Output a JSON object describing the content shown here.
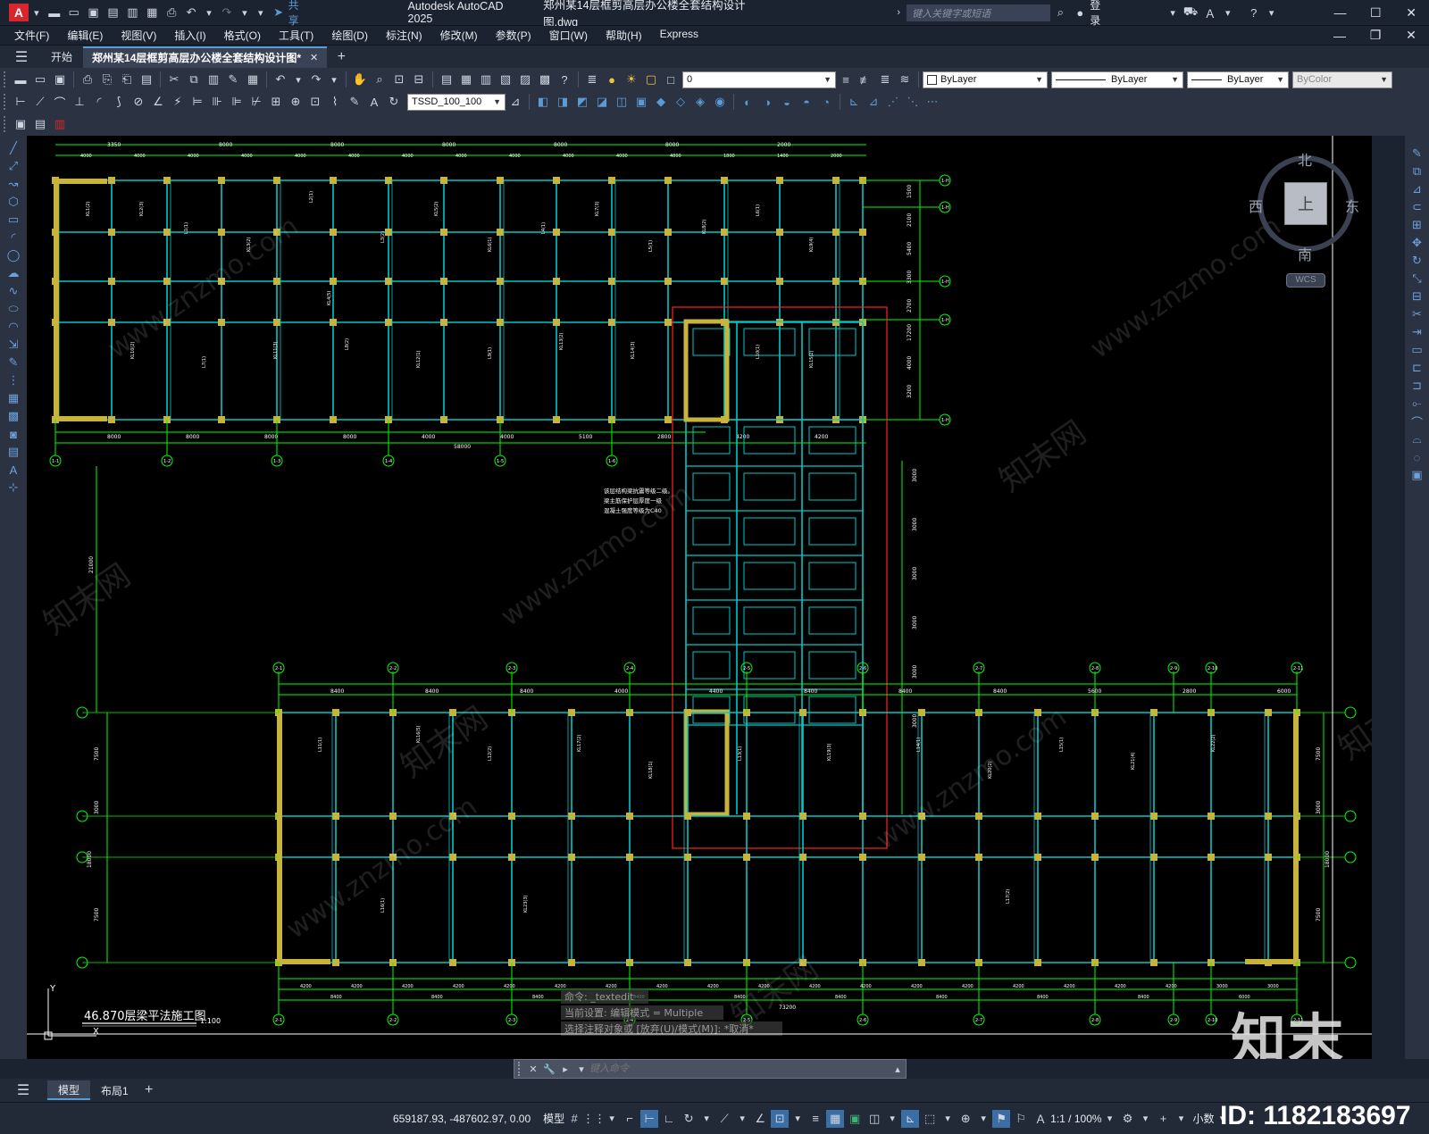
{
  "app": {
    "title": "Autodesk AutoCAD 2025",
    "document": "郑州某14层框剪高层办公楼全套结构设计图.dwg",
    "search_placeholder": "键入关键字或短语",
    "login": "登录",
    "share": "共享"
  },
  "menu": [
    "文件(F)",
    "编辑(E)",
    "视图(V)",
    "插入(I)",
    "格式(O)",
    "工具(T)",
    "绘图(D)",
    "标注(N)",
    "修改(M)",
    "参数(P)",
    "窗口(W)",
    "帮助(H)",
    "Express"
  ],
  "tabs": {
    "start": "开始",
    "doc": "郑州某14层框剪高层办公楼全套结构设计图*"
  },
  "toolbar": {
    "layer_value": "0",
    "color": "ByLayer",
    "linetype": "ByLayer",
    "lineweight": "ByLayer",
    "plotstyle": "ByColor",
    "dimstyle": "TSSD_100_100"
  },
  "viewcube": {
    "north": "北",
    "south": "南",
    "east": "东",
    "west": "西",
    "face": "上",
    "wcs": "WCS"
  },
  "drawing": {
    "title": "46.870层梁平法施工图",
    "scale": "1:100",
    "note_lines": [
      "该层结构梁抗震等级二级。",
      "梁主筋保护层厚度一级",
      "混凝土强度等级为C40"
    ],
    "top_dims_1": [
      "3350",
      "8000",
      "8000",
      "8000",
      "8000",
      "8000",
      "2000"
    ],
    "top_dims_2": [
      "4000",
      "4000",
      "4000",
      "4000",
      "4000",
      "4000",
      "4000",
      "4000",
      "4000",
      "4000",
      "4000",
      "4800",
      "1800",
      "1400",
      "2000"
    ],
    "top_bottom_dims": [
      "8000",
      "8000",
      "8000",
      "8000",
      "4000",
      "4000",
      "5100",
      "2800",
      "4200",
      "4200"
    ],
    "top_total": "58000",
    "top_axes": [
      "1-1",
      "1-2",
      "1-3",
      "1-4",
      "1-5",
      "1-6"
    ],
    "top_right_axes": [
      "1-H",
      "1-H",
      "1-H",
      "1-H",
      "1-H"
    ],
    "right_dims": [
      "1500",
      "2100",
      "5400",
      "3300",
      "2700",
      "17200",
      "4000",
      "3200"
    ],
    "mid_dims": [
      "3000",
      "3000",
      "3000",
      "3000",
      "3000",
      "3000"
    ],
    "left_dim": "21000",
    "bot_axes": [
      "2-1",
      "2-2",
      "2-3",
      "2-4",
      "2-5",
      "2-6",
      "2-7",
      "2-8",
      "2-9",
      "2-10",
      "2-11"
    ],
    "bot_dims_top": [
      "8400",
      "8400",
      "8400",
      "4000",
      "4400",
      "8400",
      "8400",
      "8400",
      "5600",
      "2800",
      "6000"
    ],
    "bot_dims_bottom": [
      "4200",
      "4200",
      "4200",
      "4200",
      "4200",
      "4200",
      "4200",
      "4200",
      "4200",
      "4200",
      "4200",
      "4200",
      "4200",
      "4200",
      "4200",
      "4200",
      "4200",
      "4200",
      "3000",
      "3000"
    ],
    "bot_dims_mid": [
      "8400",
      "8400",
      "8400",
      "8400",
      "8400",
      "8400",
      "8400",
      "8400",
      "8400",
      "6000"
    ],
    "bot_total": "73200",
    "bot_right_dims": [
      "7500",
      "3000",
      "18000",
      "7500"
    ],
    "bot_left_dims": [
      "7500",
      "3000",
      "18000",
      "7500"
    ],
    "beam_labels": [
      "KL1(2)",
      "KL2(3)",
      "L1(1)",
      "KL3(2)",
      "L2(1)",
      "KL4(5)",
      "L3(2)",
      "KL5(2)",
      "KL6(1)",
      "L4(1)",
      "KL7(3)",
      "L5(1)",
      "KL8(2)",
      "L6(1)",
      "KL9(4)",
      "KL10(2)",
      "L7(1)",
      "KL11(3)",
      "L8(2)",
      "KL12(1)",
      "L9(1)",
      "KL13(2)",
      "KL14(3)",
      "L10(1)",
      "KL15(2)",
      "L11(1)",
      "KL16(5)",
      "L12(2)",
      "KL17(2)",
      "KL18(1)",
      "L13(1)",
      "KL19(3)",
      "L14(1)",
      "KL20(2)",
      "L15(1)",
      "KL21(4)",
      "KL22(2)",
      "L16(1)",
      "KL23(3)",
      "L17(2)"
    ],
    "cmd_history": [
      "命令: _textedit",
      "当前设置: 编辑模式 = Multiple",
      "选择注释对象或 [放弃(U)/模式(M)]: *取消*"
    ]
  },
  "cmd_placeholder": "键入命令",
  "layouts": {
    "model": "模型",
    "layout1": "布局1"
  },
  "status": {
    "coords": "659187.93, -487602.97, 0.00",
    "model": "模型",
    "scale": "1:1 / 100%",
    "units": "小数"
  },
  "watermark": {
    "brand": "知末",
    "id": "ID: 1182183697",
    "url": "www.znzmo.com",
    "cn": "知末网"
  },
  "colors": {
    "bg": "#1b2230",
    "beam": "#00c8c8",
    "axis": "#00ff00",
    "column": "#c8b43c",
    "red": "#ff2020"
  }
}
